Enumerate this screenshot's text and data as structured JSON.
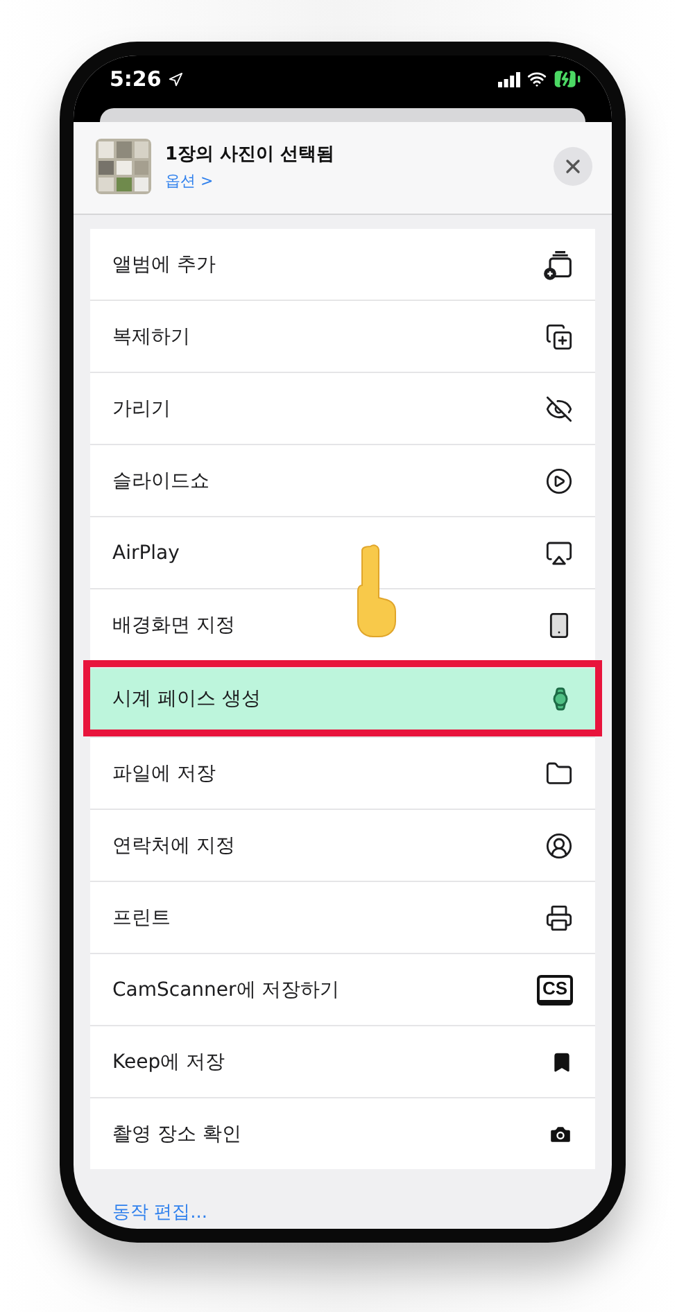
{
  "status_bar": {
    "time": "5:26"
  },
  "header": {
    "title": "1장의 사진이 선택됨",
    "options_link": "옵션 >"
  },
  "actions": [
    {
      "label": "앨범에 추가",
      "selected": false
    },
    {
      "label": "복제하기",
      "selected": false
    },
    {
      "label": "가리기",
      "selected": false
    },
    {
      "label": "슬라이드쇼",
      "selected": false
    },
    {
      "label": "AirPlay",
      "selected": false
    },
    {
      "label": "배경화면 지정",
      "selected": false
    },
    {
      "label": "시계 페이스 생성",
      "selected": true
    },
    {
      "label": "파일에 저장",
      "selected": false
    },
    {
      "label": "연락처에 지정",
      "selected": false
    },
    {
      "label": "프린트",
      "selected": false
    },
    {
      "label": "CamScanner에 저장하기",
      "selected": false
    },
    {
      "label": "Keep에 저장",
      "selected": false
    },
    {
      "label": "촬영 장소 확인",
      "selected": false
    }
  ],
  "cs_badge": "CS",
  "edit_actions_link": "동작 편집..."
}
